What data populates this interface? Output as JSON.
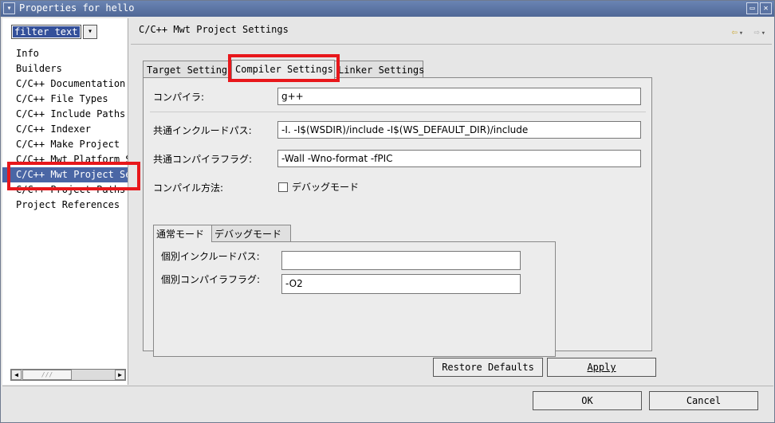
{
  "window": {
    "title": "Properties for hello",
    "menu_icon": "▾",
    "minimize_icon": "▭",
    "close_icon": "✕"
  },
  "filter": {
    "value": "filter text",
    "drop_icon": "▾"
  },
  "nav_items": [
    {
      "label": "Info"
    },
    {
      "label": "Builders"
    },
    {
      "label": "C/C++ Documentation"
    },
    {
      "label": "C/C++ File Types"
    },
    {
      "label": "C/C++ Include Paths"
    },
    {
      "label": "C/C++ Indexer"
    },
    {
      "label": "C/C++ Make Project"
    },
    {
      "label": "C/C++ Mwt Platform S"
    },
    {
      "label": "C/C++ Mwt Project Se"
    },
    {
      "label": "C/C++ Project Paths"
    },
    {
      "label": "Project References"
    }
  ],
  "selected_nav_index": 8,
  "page": {
    "title": "C/C++ Mwt Project Settings",
    "back_icon": "⇦",
    "forward_icon": "⇨",
    "drop_icon": "▾"
  },
  "tabs": [
    "Target Settings",
    "Compiler Settings",
    "Linker Settings"
  ],
  "active_tab": 1,
  "compiler": {
    "compiler_label": "コンパイラ:",
    "compiler_value": "g++",
    "include_label": "共通インクルードパス:",
    "include_value": "-I. -I$(WSDIR)/include -I$(WS_DEFAULT_DIR)/include",
    "flags_label": "共通コンパイラフラグ:",
    "flags_value": "-Wall -Wno-format -fPIC",
    "method_label": "コンパイル方法:",
    "debug_mode_label": "デバッグモード",
    "debug_mode_checked": false
  },
  "subtabs": [
    "通常モード",
    "デバッグモード"
  ],
  "active_subtab": 0,
  "mode_settings": {
    "include_label": "個別インクルードパス:",
    "include_value": "",
    "flags_label": "個別コンパイラフラグ:",
    "flags_value": "-O2"
  },
  "buttons": {
    "restore_defaults": "Restore Defaults",
    "apply": "Apply",
    "ok": "OK",
    "cancel": "Cancel"
  },
  "annotation_color": "#e8171b"
}
